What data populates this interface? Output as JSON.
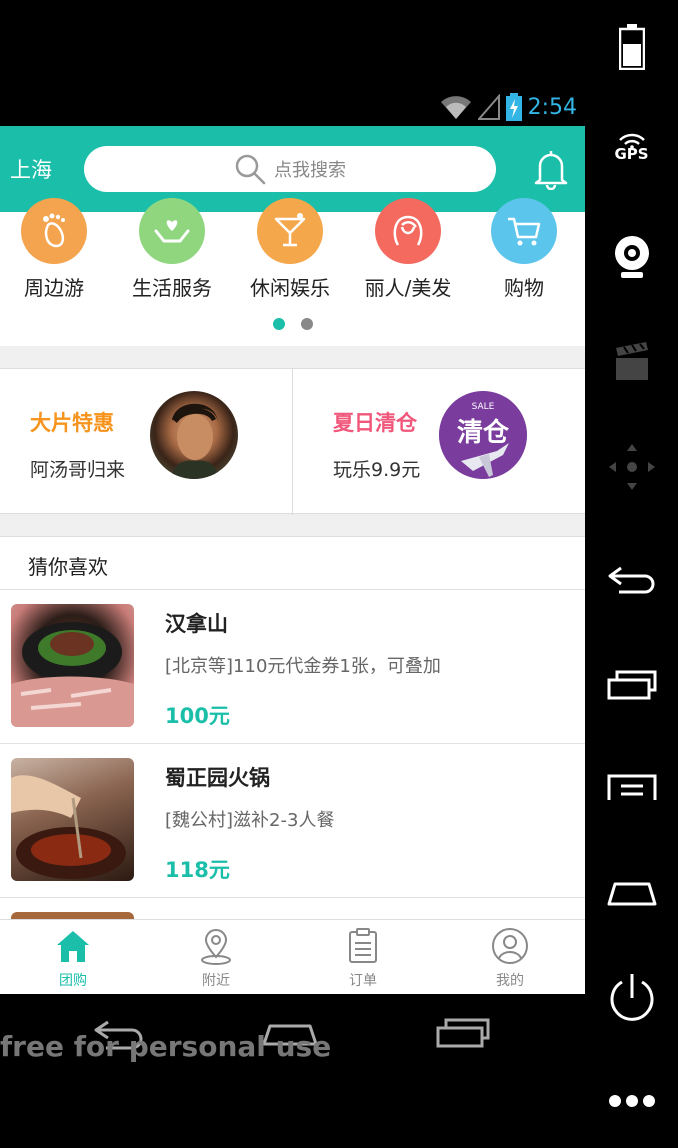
{
  "status_bar": {
    "time": "2:54"
  },
  "header": {
    "city": "上海",
    "search_placeholder": "点我搜索"
  },
  "categories": [
    {
      "label": "周边游",
      "icon": "footprint-icon",
      "color": "#f4a44f"
    },
    {
      "label": "生活服务",
      "icon": "heart-hands-icon",
      "color": "#8fd67f"
    },
    {
      "label": "休闲娱乐",
      "icon": "cocktail-icon",
      "color": "#f5a74b"
    },
    {
      "label": "丽人/美发",
      "icon": "woman-hair-icon",
      "color": "#f46a5f"
    },
    {
      "label": "购物",
      "icon": "cart-icon",
      "color": "#5cc5ec"
    }
  ],
  "pager": {
    "pages": 2,
    "active": 1
  },
  "promos": [
    {
      "title": "大片特惠",
      "subtitle": "阿汤哥归来",
      "title_color": "#f7941d"
    },
    {
      "title": "夏日清仓",
      "subtitle": "玩乐9.9元",
      "title_color": "#f0577a",
      "badge_text": "清仓",
      "badge_small": "SALE"
    }
  ],
  "guess": {
    "title": "猜你喜欢",
    "items": [
      {
        "name": "汉拿山",
        "desc": "[北京等]110元代金券1张，可叠加",
        "price": "100元"
      },
      {
        "name": "蜀正园火锅",
        "desc": "[魏公村]滋补2-3人餐",
        "price": "118元"
      }
    ]
  },
  "tabs": [
    {
      "label": "团购",
      "icon": "home-icon",
      "active": true
    },
    {
      "label": "附近",
      "icon": "location-pin-icon",
      "active": false
    },
    {
      "label": "订单",
      "icon": "clipboard-icon",
      "active": false
    },
    {
      "label": "我的",
      "icon": "user-icon",
      "active": false
    }
  ],
  "side_panel": {
    "gps_label": "GPS"
  },
  "watermark": "free for personal use",
  "colors": {
    "accent": "#1bbfa9",
    "status_time": "#33b5e5"
  }
}
